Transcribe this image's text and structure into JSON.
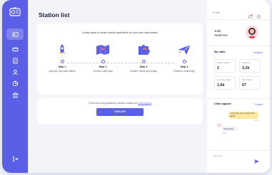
{
  "sidebar": {
    "logo_icon": "radio-logo-icon",
    "items": [
      {
        "icon": "station-list-icon",
        "active": true
      },
      {
        "icon": "video-icon",
        "active": false
      },
      {
        "icon": "document-icon",
        "active": false
      },
      {
        "icon": "users-icon",
        "active": false
      },
      {
        "icon": "chart-icon",
        "active": false
      },
      {
        "icon": "bank-icon",
        "active": false
      }
    ],
    "logout_icon": "logout-icon"
  },
  "main": {
    "title": "Station list",
    "steps_heading": "4 easy steps to create mobile application for your own radio station",
    "steps": [
      {
        "num": "Step 1",
        "desc": "Add your first radio station",
        "icon": "rocket-icon"
      },
      {
        "num": "Step 2",
        "desc": "Choose a tariff plan",
        "icon": "map-icon"
      },
      {
        "num": "Step 3",
        "desc": "Confirm mobile app design",
        "icon": "puzzle-icon"
      },
      {
        "num": "Step 4",
        "desc": "Publish a mobile app",
        "icon": "paper-plane-icon"
      }
    ],
    "help_prefix": "If you have any questions, please contact our",
    "help_link": "chat support",
    "create_label": "CREATE"
  },
  "right": {
    "profile_link": "Profile",
    "user_first": "Julia",
    "user_last": "Anderson",
    "my_radio_title": "My radio",
    "analytics_link": "Analytics",
    "stats": [
      {
        "label": "Active stations",
        "value": "2"
      },
      {
        "label": "Listeners",
        "value": "3,2k"
      },
      {
        "label": "Listening today",
        "value": "1,6k"
      },
      {
        "label": "Mins listens",
        "value": "67"
      }
    ],
    "chat_title": "Chat support",
    "chat_link": "Expand",
    "incoming_msg": "I can help you to know the tariffs",
    "incoming_time": "12:24",
    "outgoing_msg": "Interesting",
    "outgoing_time": "12:26",
    "message_placeholder": "Message..."
  },
  "colors": {
    "accent": "#5b5fe6",
    "bg": "#f3f4fa",
    "notify": "#ff4d6d",
    "bubble": "#fde8a0"
  }
}
